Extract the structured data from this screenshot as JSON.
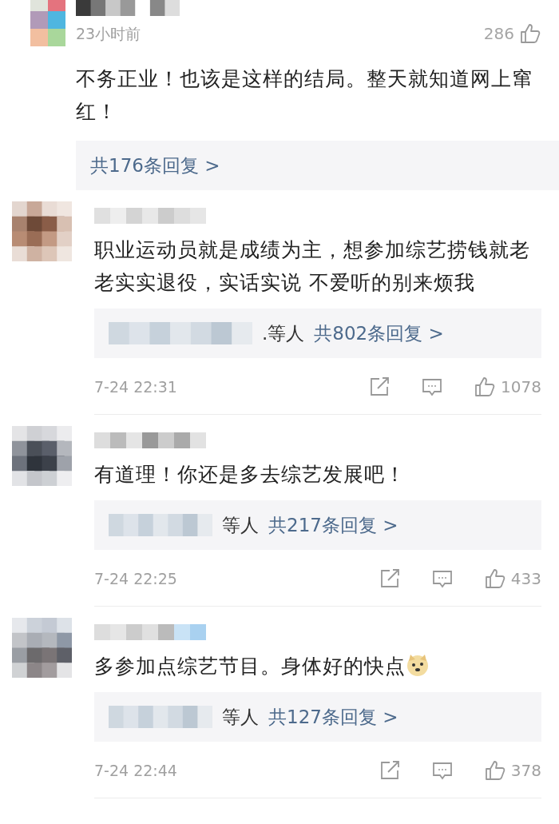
{
  "comments": [
    {
      "kind": "top",
      "likes": "286",
      "time": "23小时前",
      "text": "不务正业！也该是这样的结局。整天就知道网上窜红！",
      "has_emoji": false,
      "replies": {
        "total": "共176条回复 >"
      }
    },
    {
      "kind": "full",
      "likes": "1078",
      "time": "7-24 22:31",
      "text": "职业运动员就是成绩为主，想参加综艺捞钱就老老实实退役，实话实说 不爱听的别来烦我",
      "has_emoji": false,
      "replies": {
        "who": ".等人",
        "total": "共802条回复 >"
      }
    },
    {
      "kind": "full",
      "likes": "433",
      "time": "7-24 22:25",
      "text": "有道理！你还是多去综艺发展吧！",
      "has_emoji": false,
      "replies": {
        "who": "等人",
        "total": "共217条回复 >"
      }
    },
    {
      "kind": "full",
      "likes": "378",
      "time": "7-24 22:44",
      "text": "多参加点综艺节目。身体好的快点",
      "has_emoji": true,
      "replies": {
        "who": "等人",
        "total": "共127条回复 >"
      }
    }
  ]
}
